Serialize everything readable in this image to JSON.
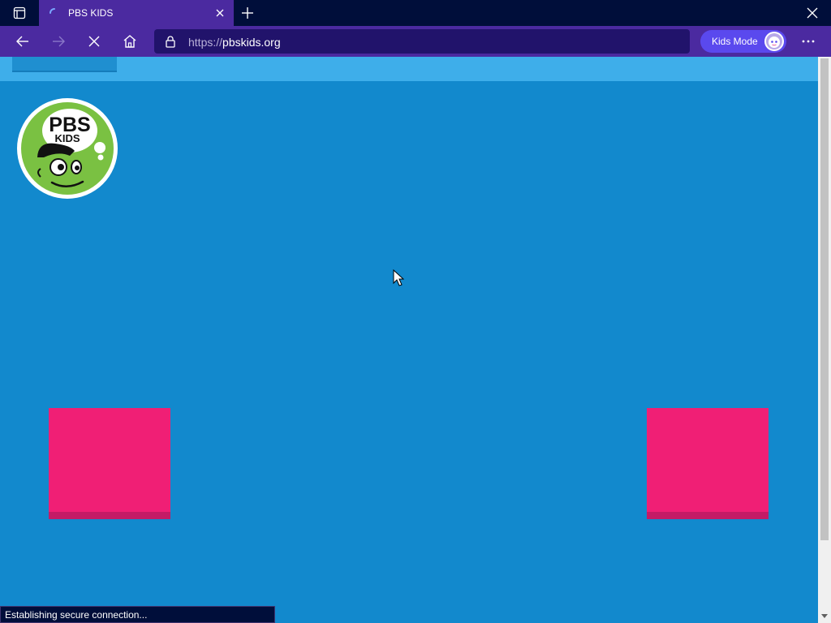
{
  "browser": {
    "tab": {
      "title": "PBS KIDS"
    },
    "address": {
      "protocol": "https://",
      "domain": "pbskids.org"
    },
    "kids_mode_label": "Kids Mode",
    "status_text": "Establishing secure connection..."
  },
  "page": {
    "logo": {
      "line1": "PBS",
      "line2": "KIDS"
    }
  },
  "colors": {
    "tab_strip": "#000e3a",
    "toolbar": "#4b2aa0",
    "page_background": "#1289cd",
    "top_band": "#3eaeea",
    "pink_box": "#f01f75",
    "logo_green": "#7ac142"
  }
}
